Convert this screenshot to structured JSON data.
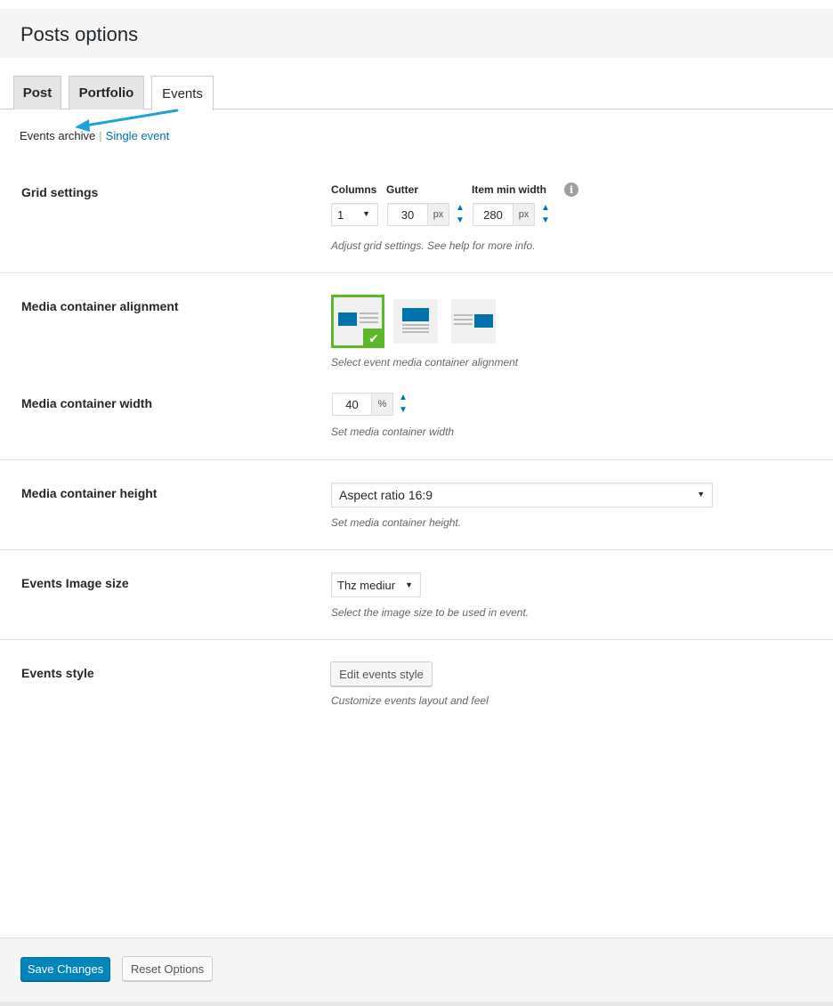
{
  "header": {
    "title": "Posts options"
  },
  "tabs": [
    {
      "label": "Post"
    },
    {
      "label": "Portfolio"
    },
    {
      "label": "Events",
      "active": true
    }
  ],
  "subnav": {
    "current": "Events archive",
    "separator": "|",
    "link": "Single event"
  },
  "grid_settings": {
    "label": "Grid settings",
    "columns_label": "Columns",
    "columns_value": "1",
    "gutter_label": "Gutter",
    "gutter_value": "30",
    "gutter_unit": "px",
    "item_min_width_label": "Item min width",
    "item_min_width_value": "280",
    "item_min_width_unit": "px",
    "description": "Adjust grid settings. See help for more info."
  },
  "media_alignment": {
    "label": "Media container alignment",
    "options": [
      "left",
      "top",
      "right"
    ],
    "selected": "left",
    "description": "Select event media container alignment"
  },
  "media_width": {
    "label": "Media container width",
    "value": "40",
    "unit": "%",
    "description": "Set media container width"
  },
  "media_height": {
    "label": "Media container height",
    "value": "Aspect ratio 16:9",
    "description": "Set media container height."
  },
  "image_size": {
    "label": "Events Image size",
    "value": "Thz mediur",
    "description": "Select the image size to be used in event."
  },
  "events_style": {
    "label": "Events style",
    "button": "Edit events style",
    "description": "Customize events layout and feel"
  },
  "footer": {
    "save": "Save Changes",
    "reset": "Reset Options"
  },
  "colors": {
    "accent": "#0073aa",
    "selected": "#5cb829",
    "primary_button": "#0085ba",
    "annotation_arrow": "#1ea0dc"
  },
  "icons": {
    "info": "info-icon",
    "check": "check-icon",
    "caret": "chevron-down-icon",
    "spinner": "up-down-arrows-icon"
  }
}
